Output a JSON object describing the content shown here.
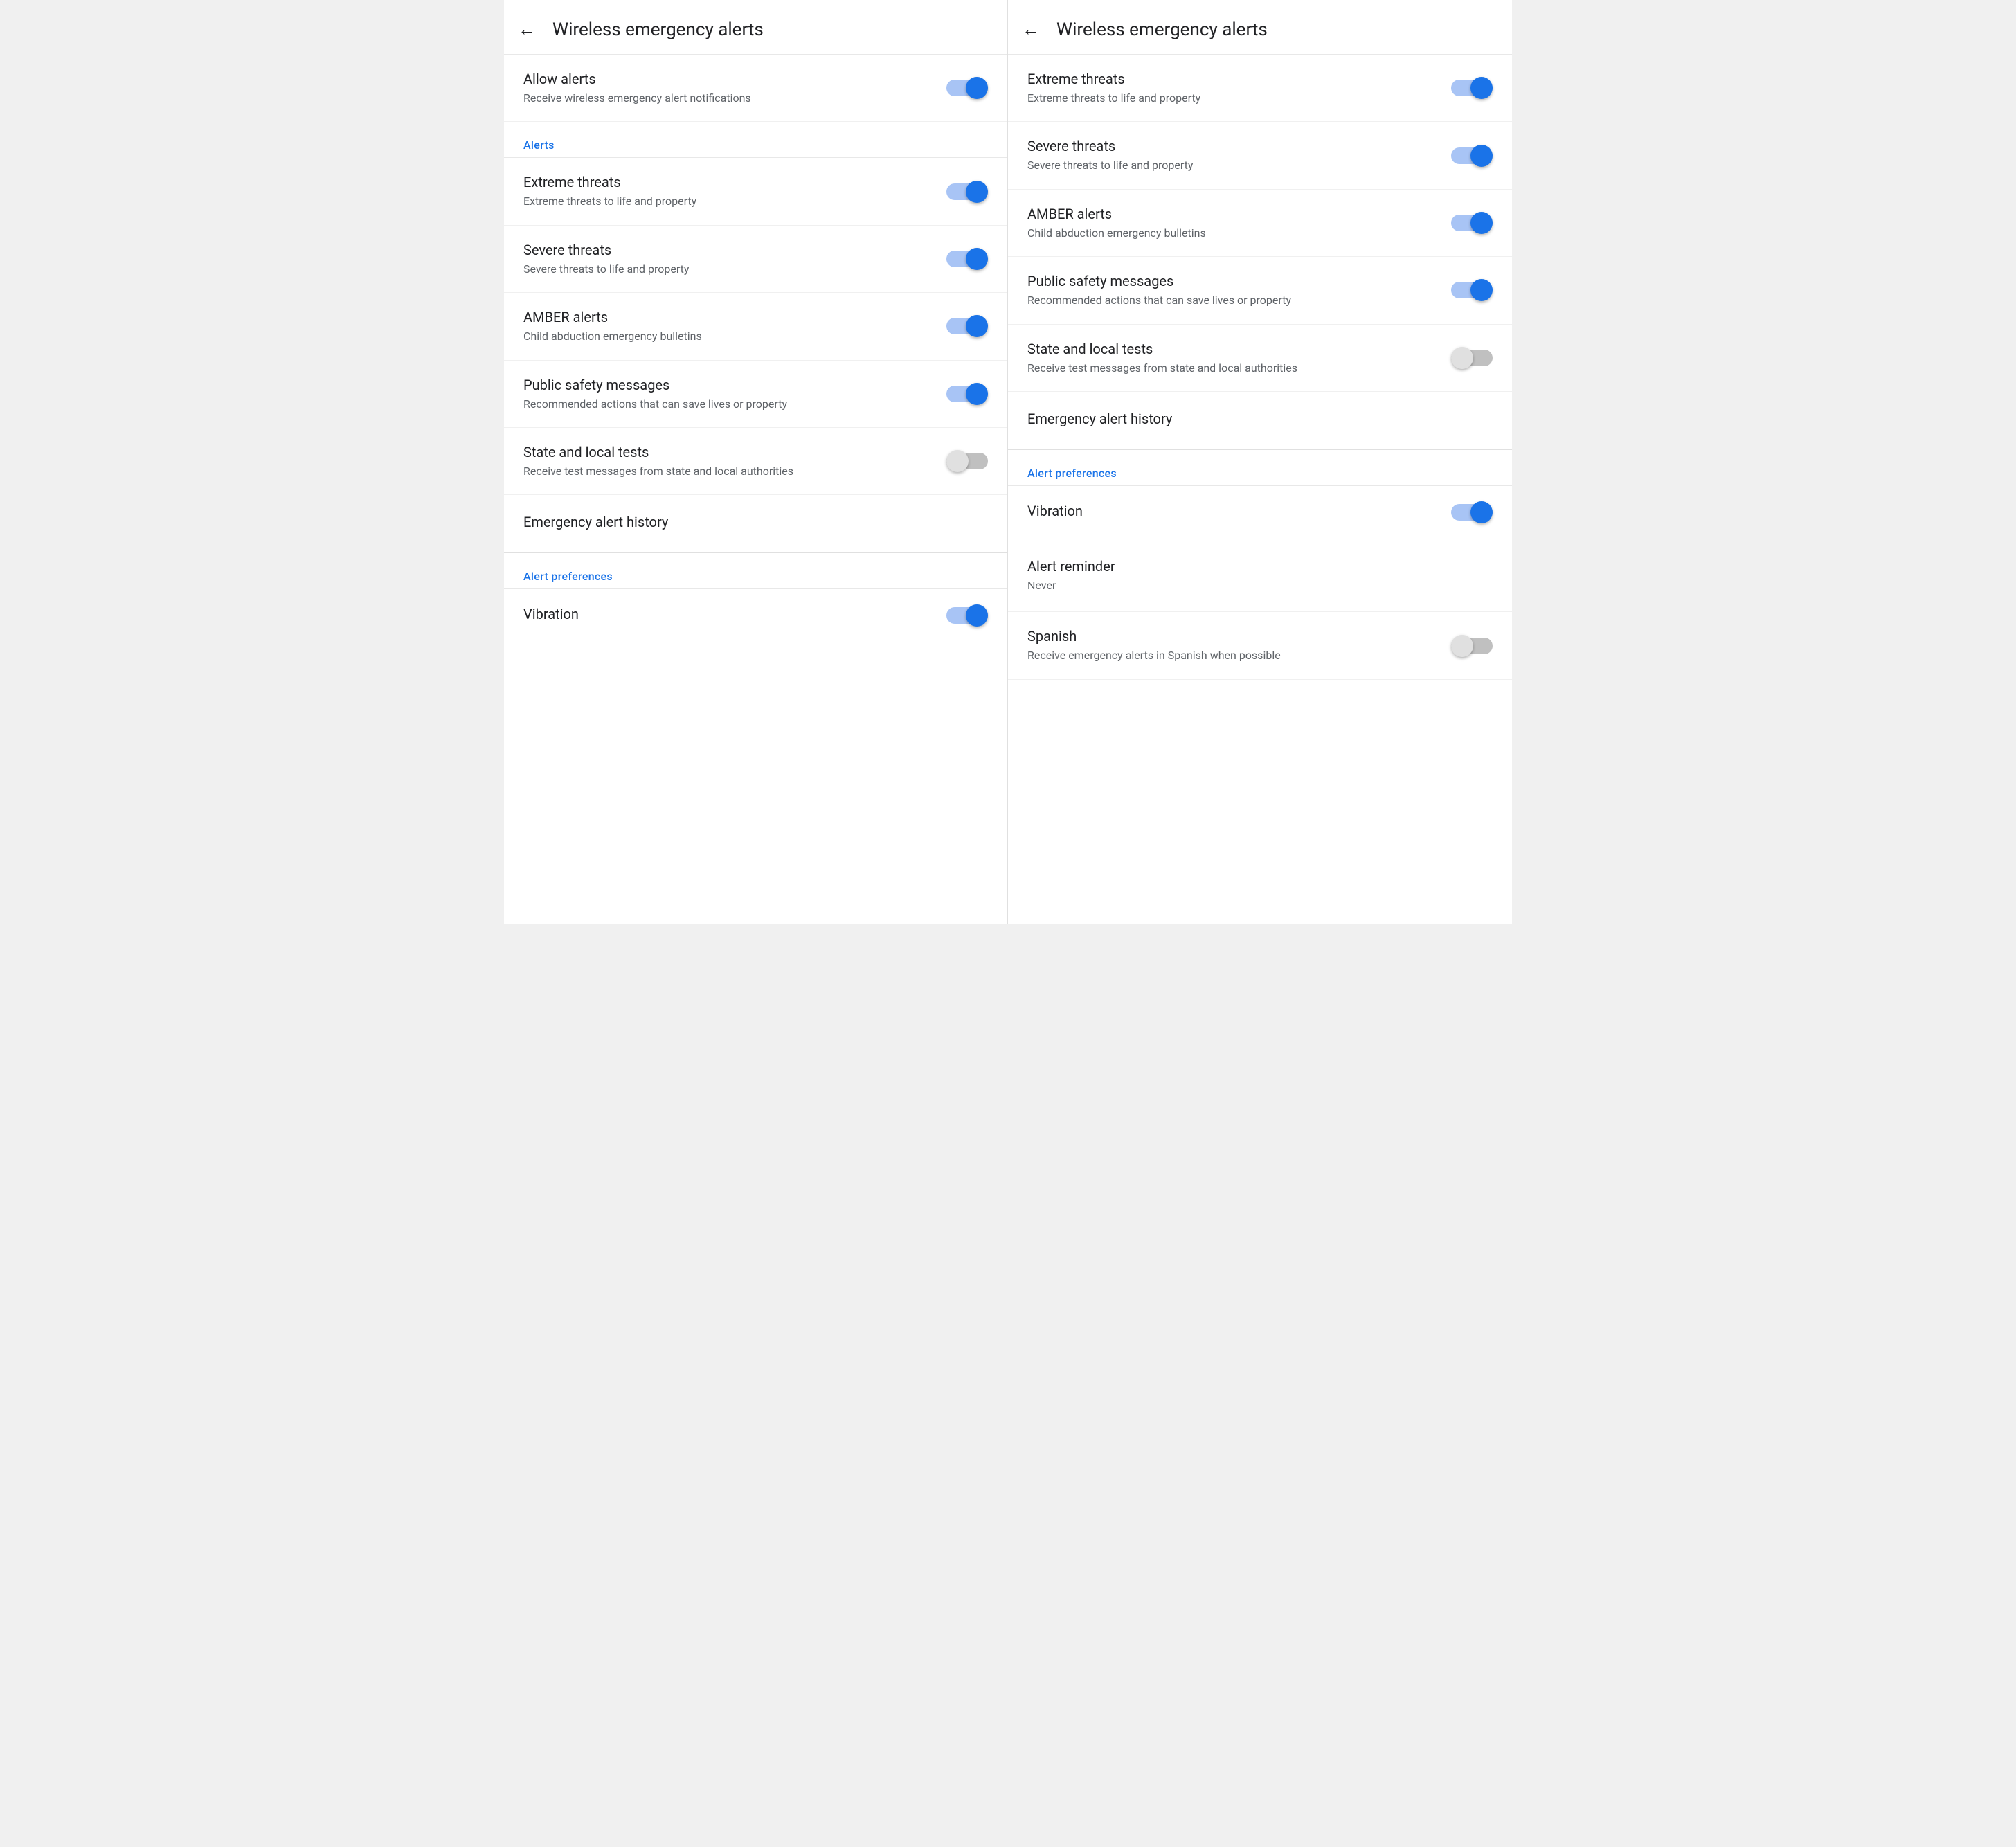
{
  "screens": [
    {
      "id": "screen-left",
      "header": {
        "back_label": "←",
        "title": "Wireless emergency alerts"
      },
      "sections": [
        {
          "type": "items",
          "items": [
            {
              "id": "allow-alerts",
              "title": "Allow alerts",
              "subtitle": "Receive wireless emergency alert notifications",
              "has_toggle": true,
              "toggle_on": true
            }
          ]
        },
        {
          "type": "section-header",
          "label": "Alerts"
        },
        {
          "type": "items",
          "items": [
            {
              "id": "extreme-threats",
              "title": "Extreme threats",
              "subtitle": "Extreme threats to life and property",
              "has_toggle": true,
              "toggle_on": true
            },
            {
              "id": "severe-threats",
              "title": "Severe threats",
              "subtitle": "Severe threats to life and property",
              "has_toggle": true,
              "toggle_on": true
            },
            {
              "id": "amber-alerts",
              "title": "AMBER alerts",
              "subtitle": "Child abduction emergency bulletins",
              "has_toggle": true,
              "toggle_on": true
            },
            {
              "id": "public-safety",
              "title": "Public safety messages",
              "subtitle": "Recommended actions that can save lives or property",
              "has_toggle": true,
              "toggle_on": true
            },
            {
              "id": "state-local-tests",
              "title": "State and local tests",
              "subtitle": "Receive test messages from state and local authorities",
              "has_toggle": true,
              "toggle_on": false
            }
          ]
        },
        {
          "type": "plain-item",
          "id": "emergency-alert-history",
          "title": "Emergency alert history"
        },
        {
          "type": "section-divider"
        },
        {
          "type": "section-header",
          "label": "Alert preferences"
        },
        {
          "type": "items",
          "items": [
            {
              "id": "vibration",
              "title": "Vibration",
              "subtitle": null,
              "has_toggle": true,
              "toggle_on": true
            }
          ]
        }
      ]
    },
    {
      "id": "screen-right",
      "header": {
        "back_label": "←",
        "title": "Wireless emergency alerts"
      },
      "sections": [
        {
          "type": "items",
          "items": [
            {
              "id": "extreme-threats-r",
              "title": "Extreme threats",
              "subtitle": "Extreme threats to life and property",
              "has_toggle": true,
              "toggle_on": true
            },
            {
              "id": "severe-threats-r",
              "title": "Severe threats",
              "subtitle": "Severe threats to life and property",
              "has_toggle": true,
              "toggle_on": true
            },
            {
              "id": "amber-alerts-r",
              "title": "AMBER alerts",
              "subtitle": "Child abduction emergency bulletins",
              "has_toggle": true,
              "toggle_on": true
            },
            {
              "id": "public-safety-r",
              "title": "Public safety messages",
              "subtitle": "Recommended actions that can save lives or property",
              "has_toggle": true,
              "toggle_on": true
            },
            {
              "id": "state-local-tests-r",
              "title": "State and local tests",
              "subtitle": "Receive test messages from state and local authorities",
              "has_toggle": true,
              "toggle_on": false
            }
          ]
        },
        {
          "type": "plain-item",
          "id": "emergency-alert-history-r",
          "title": "Emergency alert history"
        },
        {
          "type": "section-divider"
        },
        {
          "type": "section-header",
          "label": "Alert preferences"
        },
        {
          "type": "items",
          "items": [
            {
              "id": "vibration-r",
              "title": "Vibration",
              "subtitle": null,
              "has_toggle": true,
              "toggle_on": true
            }
          ]
        },
        {
          "type": "plain-item-with-subtitle",
          "id": "alert-reminder-r",
          "title": "Alert reminder",
          "subtitle": "Never"
        },
        {
          "type": "items",
          "items": [
            {
              "id": "spanish-r",
              "title": "Spanish",
              "subtitle": "Receive emergency alerts in Spanish when possible",
              "has_toggle": true,
              "toggle_on": false
            }
          ]
        }
      ]
    }
  ]
}
